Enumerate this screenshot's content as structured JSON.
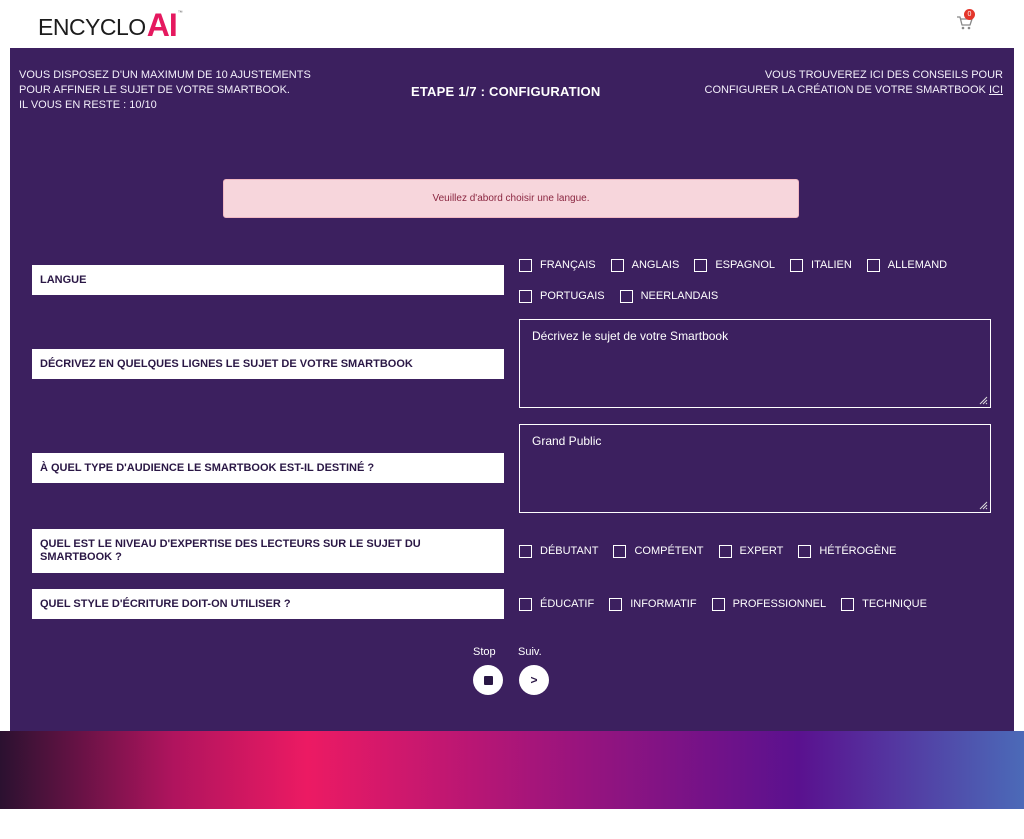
{
  "brand": {
    "logo_text": "ENCYCLO",
    "logo_ai": "AI",
    "logo_tm": "™"
  },
  "cart": {
    "count": "0"
  },
  "header": {
    "left_lines": [
      "VOUS DISPOSEZ D'UN MAXIMUM DE 10 AJUSTEMENTS",
      "POUR AFFINER LE SUJET DE VOTRE SMARTBOOK.",
      "IL VOUS EN RESTE : 10/10"
    ],
    "step_title": "ETAPE 1/7 : CONFIGURATION",
    "right_line1": "VOUS TROUVEREZ ICI DES CONSEILS POUR",
    "right_line2": "CONFIGURER LA CRÉATION DE VOTRE SMARTBOOK",
    "right_link": "ICI"
  },
  "alert": {
    "message": "Veuillez d'abord choisir une langue."
  },
  "form": {
    "language": {
      "label": "LANGUE",
      "options_row1": [
        "FRANÇAIS",
        "ANGLAIS",
        "ESPAGNOL",
        "ITALIEN",
        "ALLEMAND"
      ],
      "options_row2": [
        "PORTUGAIS",
        "NEERLANDAIS"
      ]
    },
    "subject": {
      "label": "DÉCRIVEZ EN QUELQUES LIGNES LE SUJET DE VOTRE SMARTBOOK",
      "placeholder": "Décrivez le sujet de votre Smartbook"
    },
    "audience": {
      "label": "À QUEL TYPE D'AUDIENCE LE SMARTBOOK EST-IL DESTINÉ ?",
      "value": "Grand Public"
    },
    "expertise": {
      "label": "QUEL EST LE NIVEAU D'EXPERTISE DES LECTEURS SUR LE SUJET DU SMARTBOOK ?",
      "options": [
        "DÉBUTANT",
        "COMPÉTENT",
        "EXPERT",
        "HÉTÉROGÈNE"
      ]
    },
    "style": {
      "label": "QUEL STYLE D'ÉCRITURE DOIT-ON UTILISER ?",
      "options": [
        "ÉDUCATIF",
        "INFORMATIF",
        "PROFESSIONNEL",
        "TECHNIQUE"
      ]
    }
  },
  "controls": {
    "stop_label": "Stop",
    "next_label": "Suiv.",
    "next_symbol": ">"
  },
  "colors": {
    "panel": "#3c205f",
    "accent": "#e5195f",
    "alert_bg": "#f7d6dc",
    "alert_text": "#8b2741"
  }
}
